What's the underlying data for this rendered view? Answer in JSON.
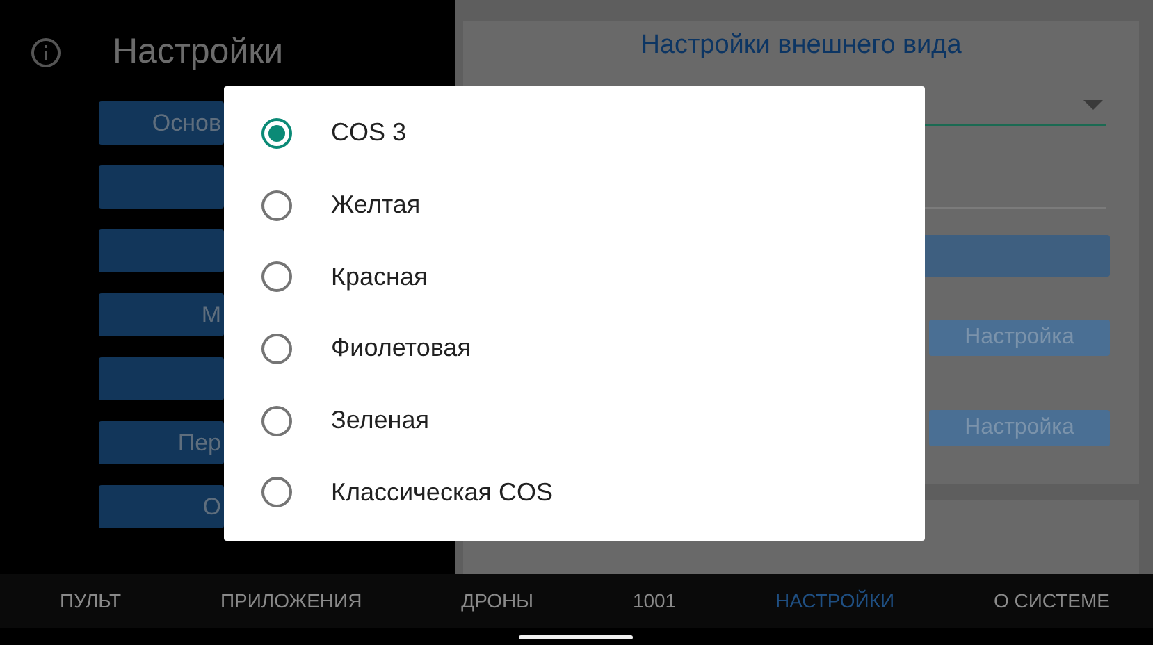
{
  "header": {
    "title": "Настройки"
  },
  "menu_buttons": [
    {
      "kind": "text",
      "label": "Основ"
    },
    {
      "kind": "blank"
    },
    {
      "kind": "blank"
    },
    {
      "kind": "text",
      "label": "М"
    },
    {
      "kind": "blank"
    },
    {
      "kind": "text",
      "label": "Пер"
    },
    {
      "kind": "text",
      "label": "О"
    }
  ],
  "appearance": {
    "title": "Настройки внешнего вида",
    "setting_buttons": [
      "Настройка",
      "Настройка"
    ]
  },
  "dialog": {
    "options": [
      {
        "label": "COS 3",
        "selected": true
      },
      {
        "label": "Желтая",
        "selected": false
      },
      {
        "label": "Красная",
        "selected": false
      },
      {
        "label": "Фиолетовая",
        "selected": false
      },
      {
        "label": "Зеленая",
        "selected": false
      },
      {
        "label": "Классическая COS",
        "selected": false
      }
    ]
  },
  "bottom_nav": [
    {
      "label": "ПУЛЬТ",
      "selected": false
    },
    {
      "label": "ПРИЛОЖЕНИЯ",
      "selected": false
    },
    {
      "label": "ДРОНЫ",
      "selected": false
    },
    {
      "label": "1001",
      "selected": false
    },
    {
      "label": "НАСТРОЙКИ",
      "selected": true
    },
    {
      "label": "О СИСТЕМЕ",
      "selected": false
    }
  ]
}
